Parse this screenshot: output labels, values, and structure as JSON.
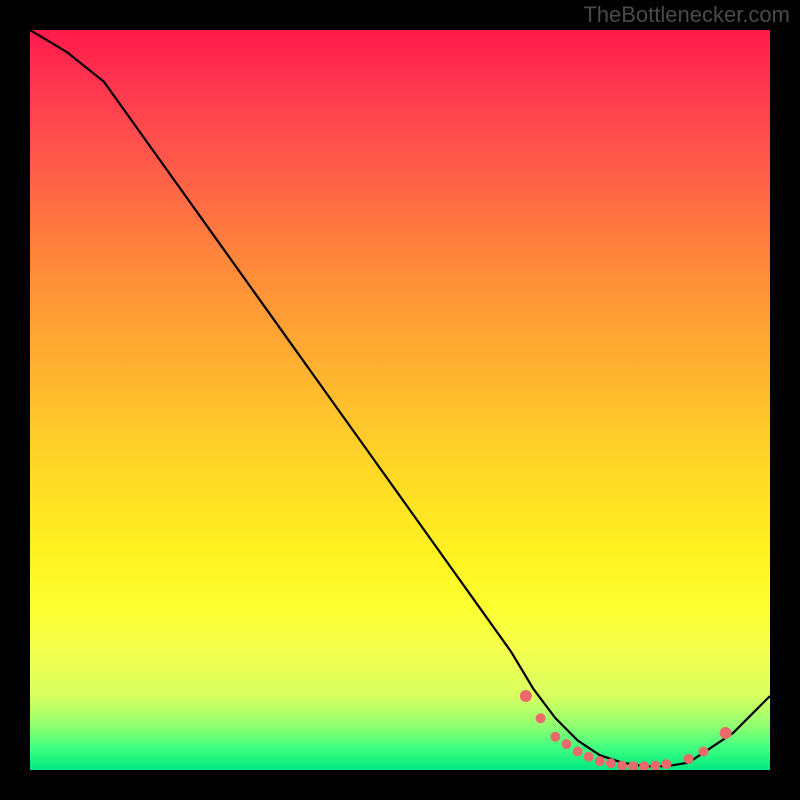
{
  "attribution": "TheBottlenecker.com",
  "chart_data": {
    "type": "line",
    "title": "",
    "xlabel": "",
    "ylabel": "",
    "xlim": [
      0,
      100
    ],
    "ylim": [
      0,
      100
    ],
    "series": [
      {
        "name": "curve",
        "x": [
          0,
          5,
          10,
          15,
          20,
          25,
          30,
          35,
          40,
          45,
          50,
          55,
          60,
          65,
          68,
          71,
          74,
          77,
          80,
          83,
          86,
          89,
          92,
          95,
          98,
          100
        ],
        "y": [
          100,
          97,
          93,
          86,
          79,
          72,
          65,
          58,
          51,
          44,
          37,
          30,
          23,
          16,
          11,
          7,
          4,
          2,
          1,
          0.5,
          0.5,
          1,
          3,
          5,
          8,
          10
        ]
      }
    ],
    "dots": {
      "name": "highlight-points",
      "x": [
        67,
        69,
        71,
        72.5,
        74,
        75.5,
        77,
        78.5,
        80,
        81.5,
        83,
        84.5,
        86,
        89,
        91,
        94
      ],
      "y": [
        10,
        7,
        4.5,
        3.5,
        2.5,
        1.8,
        1.2,
        0.9,
        0.6,
        0.5,
        0.5,
        0.6,
        0.8,
        1.5,
        2.5,
        5
      ]
    },
    "background_gradient": {
      "top": "#ff1a4a",
      "mid": "#ffd428",
      "bottom": "#00e880"
    }
  }
}
